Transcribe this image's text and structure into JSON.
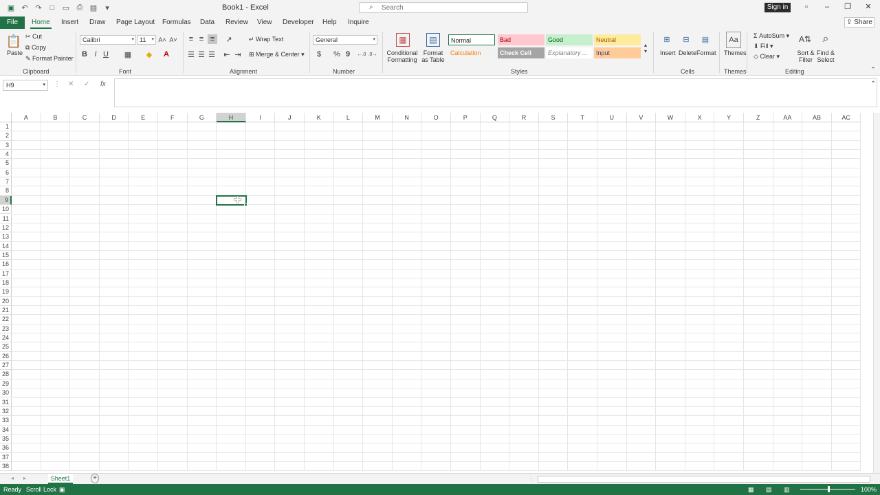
{
  "titlebar": {
    "title": "Book1 - Excel",
    "search_placeholder": "Search",
    "signin_label": "Sign in"
  },
  "tabs": {
    "file": "File",
    "items": [
      "Home",
      "Insert",
      "Draw",
      "Page Layout",
      "Formulas",
      "Data",
      "Review",
      "View",
      "Developer",
      "Help",
      "Inquire"
    ],
    "active": "Home",
    "share": "Share"
  },
  "ribbon": {
    "clipboard": {
      "label": "Clipboard",
      "paste": "Paste",
      "cut": "Cut",
      "copy": "Copy",
      "format_painter": "Format Painter"
    },
    "font": {
      "label": "Font",
      "family": "Calibri",
      "size": "11",
      "bold": "B",
      "italic": "I",
      "underline": "U"
    },
    "alignment": {
      "label": "Alignment",
      "wrap_text": "Wrap Text",
      "merge_center": "Merge & Center"
    },
    "number": {
      "label": "Number",
      "format": "General",
      "currency": "$",
      "percent": "%",
      "comma": "9"
    },
    "styles": {
      "label": "Styles",
      "conditional_formatting": "Conditional Formatting",
      "format_as_table": "Format as Table",
      "cells": [
        {
          "name": "Normal",
          "bg": "#ffffff",
          "fg": "#222222"
        },
        {
          "name": "Bad",
          "bg": "#ffc7ce",
          "fg": "#9c0006"
        },
        {
          "name": "Good",
          "bg": "#c6efce",
          "fg": "#006100"
        },
        {
          "name": "Neutral",
          "bg": "#ffeb9c",
          "fg": "#9c5700"
        },
        {
          "name": "Calculation",
          "bg": "#f2f2f2",
          "fg": "#fa7d00"
        },
        {
          "name": "Check Cell",
          "bg": "#a5a5a5",
          "fg": "#ffffff"
        },
        {
          "name": "Explanatory ...",
          "bg": "#ffffff",
          "fg": "#7f7f7f"
        },
        {
          "name": "Input",
          "bg": "#ffcc99",
          "fg": "#3f3f76"
        }
      ]
    },
    "cells": {
      "label": "Cells",
      "insert": "Insert",
      "delete": "Delete",
      "format": "Format"
    },
    "themes": {
      "label": "Themes",
      "themes": "Themes"
    },
    "editing": {
      "label": "Editing",
      "autosum": "AutoSum",
      "fill": "Fill",
      "clear": "Clear",
      "sort_filter": "Sort & Filter",
      "find_select": "Find & Select"
    }
  },
  "formula_bar": {
    "name_box": "H9",
    "fx": "fx",
    "value": ""
  },
  "grid": {
    "columns": [
      "A",
      "B",
      "C",
      "D",
      "E",
      "F",
      "G",
      "H",
      "I",
      "J",
      "K",
      "L",
      "M",
      "N",
      "O",
      "P",
      "Q",
      "R",
      "S",
      "T",
      "U",
      "V",
      "W",
      "X",
      "Y",
      "Z",
      "AA",
      "AB",
      "AC"
    ],
    "row_count": 38,
    "selected_column": "H",
    "selected_row": 9
  },
  "sheets": {
    "tabs": [
      "Sheet1"
    ],
    "add": "+"
  },
  "status": {
    "ready": "Ready",
    "scroll_lock": "Scroll Lock",
    "zoom": "100%"
  },
  "colors": {
    "accent": "#217346"
  }
}
